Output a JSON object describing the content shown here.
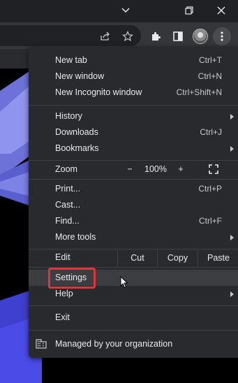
{
  "colors": {
    "menu_bg": "#292a2d",
    "hover_bg": "#3c3d41",
    "highlight": "#e0343a",
    "toolbar_bg": "#35363a"
  },
  "window_controls": {
    "icons": [
      "chevron-down-icon",
      "restore-icon",
      "close-icon"
    ]
  },
  "toolbar": {
    "icons": [
      "share-icon",
      "bookmark-star-icon",
      "extensions-icon",
      "side-panel-icon",
      "profile-avatar",
      "more-vert-icon"
    ]
  },
  "menu": {
    "new_tab": {
      "label": "New tab",
      "shortcut": "Ctrl+T"
    },
    "new_window": {
      "label": "New window",
      "shortcut": "Ctrl+N"
    },
    "new_incognito": {
      "label": "New Incognito window",
      "shortcut": "Ctrl+Shift+N"
    },
    "history": {
      "label": "History"
    },
    "downloads": {
      "label": "Downloads",
      "shortcut": "Ctrl+J"
    },
    "bookmarks": {
      "label": "Bookmarks"
    },
    "zoom": {
      "label": "Zoom",
      "minus": "−",
      "value": "100%",
      "plus": "+"
    },
    "print": {
      "label": "Print...",
      "shortcut": "Ctrl+P"
    },
    "cast": {
      "label": "Cast..."
    },
    "find": {
      "label": "Find...",
      "shortcut": "Ctrl+F"
    },
    "more_tools": {
      "label": "More tools"
    },
    "edit": {
      "label": "Edit",
      "cut": "Cut",
      "copy": "Copy",
      "paste": "Paste"
    },
    "settings": {
      "label": "Settings"
    },
    "help": {
      "label": "Help"
    },
    "exit": {
      "label": "Exit"
    },
    "managed": {
      "label": "Managed by your organization"
    }
  }
}
